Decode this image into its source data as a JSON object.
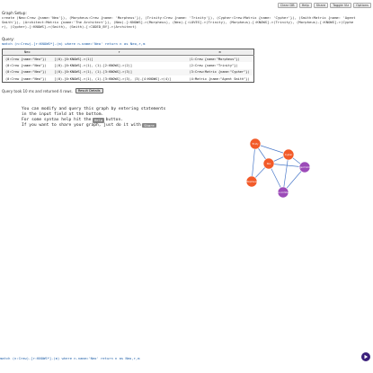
{
  "toolbar": {
    "clear_db": "Clear DB",
    "help": "Help",
    "share": "Share",
    "toggle_viz": "Toggle Viz",
    "options": "Options"
  },
  "setup": {
    "label": "Graph Setup:",
    "code": "create (Neo:Crew {name:'Neo'}), (Morpheus:Crew {name: 'Morpheus'}), (Trinity:Crew {name: 'Trinity'}), (Cypher:Crew:Matrix {name: 'Cypher'}), (Smith:Matrix {name: 'Agent Smith'}), (Architect:Matrix {name:'The Architect'}), (Neo)-[:KNOWS]->(Morpheus), (Neo)-[:LOVES]->(Trinity), (Morpheus)-[:KNOWS]->(Trinity), (Morpheus)-[:KNOWS]->(Cypher), (Cypher)-[:KNOWS]->(Smith), (Smith)-[:CODED_BY]->(Architect)"
  },
  "query": {
    "label": "Query:",
    "code": "match (n:Crew)-[r:KNOWS*]-(m) where n.name='Neo' return n as Neo,r,m"
  },
  "results": {
    "columns": [
      "Neo",
      "r",
      "m"
    ],
    "rows": [
      [
        "(0:Crew {name:\"Neo\"})",
        "[(0)-[0:KNOWS]->(1)]",
        "(1:Crew {name:\"Morpheus\"})"
      ],
      [
        "(0:Crew {name:\"Neo\"})",
        "[(0)-[0:KNOWS]->(1), (1)-[2:KNOWS]->(2)]",
        "(2:Crew {name:\"Trinity\"})"
      ],
      [
        "(0:Crew {name:\"Neo\"})",
        "[(0)-[0:KNOWS]->(1), (1)-[3:KNOWS]->(3)]",
        "(3:Crew:Matrix {name:\"Cypher\"})"
      ],
      [
        "(0:Crew {name:\"Neo\"})",
        "[(0)-[0:KNOWS]->(1), (1)-[3:KNOWS]->(3), (3)-[4:KNOWS]->(4)]",
        "(4:Matrix {name:\"Agent Smith\"})"
      ]
    ]
  },
  "status": {
    "text": "Query took 10 ms and returned 4 rows.",
    "button": "Result Details"
  },
  "intro": {
    "line1": "You can modify and query this graph by entering statements",
    "line2": "in the input field at the bottom.",
    "line3_pre": "For some syntax help hit the",
    "line3_btn": "Help",
    "line3_post": "button.",
    "line4_pre": "If you want to share your graph, just do it with",
    "line4_btn": "Share"
  },
  "graph": {
    "nodes": [
      {
        "id": "neo",
        "label": "Neo",
        "color": "#f25a29"
      },
      {
        "id": "morpheus",
        "label": "Morpheus",
        "color": "#f25a29"
      },
      {
        "id": "trinity",
        "label": "Trinity",
        "color": "#f25a29"
      },
      {
        "id": "cypher",
        "label": "Cypher",
        "color": "#f25a29"
      },
      {
        "id": "smith",
        "label": "Agent Smith",
        "color": "#9c4bb8"
      },
      {
        "id": "architect",
        "label": "The Architect",
        "color": "#9c4bb8"
      }
    ],
    "edge_color": "#4a79c9"
  },
  "input": {
    "value": "match (n:Crew)-[r:KNOWS*]-(m) where n.name='Neo' return n as Neo,r,m"
  }
}
